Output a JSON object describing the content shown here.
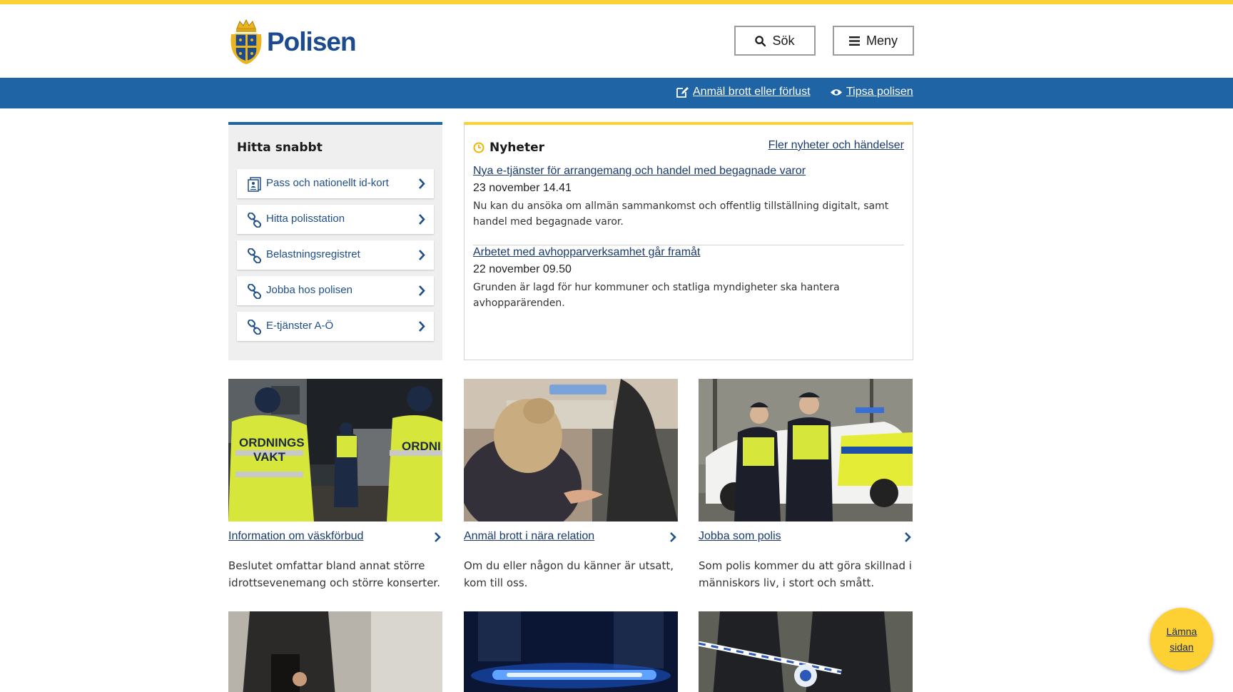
{
  "brand": {
    "name": "Polisen",
    "primary_color": "#1f64a5",
    "accent_color": "#fdd033"
  },
  "header": {
    "search_label": "Sök",
    "menu_label": "Meny"
  },
  "bluebar": {
    "report_label": "Anmäl brott eller förlust",
    "tip_label": "Tipsa polisen"
  },
  "quick": {
    "title": "Hitta snabbt",
    "items": [
      {
        "label": "Pass och nationellt id-kort",
        "icon": "id-card-icon"
      },
      {
        "label": "Hitta polisstation",
        "icon": "link-icon"
      },
      {
        "label": "Belastningsregistret",
        "icon": "link-icon"
      },
      {
        "label": "Jobba hos polisen",
        "icon": "link-icon"
      },
      {
        "label": "E-tjänster A-Ö",
        "icon": "link-icon"
      }
    ]
  },
  "news": {
    "title": "Nyheter",
    "more_label": "Fler nyheter och händelser",
    "articles": [
      {
        "title": "Nya e-tjänster för arrangemang och handel med begagnade varor",
        "date": "23 november 14.41",
        "text": "Nu kan du ansöka om allmän sammankomst och offentlig tillställning digitalt, samt handel med begagnade varor."
      },
      {
        "title": "Arbetet med avhopparverksamhet går framåt",
        "date": "22 november 09.50",
        "text": "Grunden är lagd för hur kommuner och statliga myndigheter ska hantera avhopparärenden."
      }
    ]
  },
  "cards": [
    {
      "link": "Information om väskförbud",
      "desc": "Beslutet omfattar bland annat större idrottsevenemang och större konserter."
    },
    {
      "link": "Anmäl brott i nära relation",
      "desc": "Om du eller någon du känner är utsatt, kom till oss."
    },
    {
      "link": "Jobba som polis",
      "desc": "Som polis kommer du att göra skillnad i människors liv, i stort och smått."
    }
  ],
  "leave": {
    "label": "Lämna sidan"
  }
}
